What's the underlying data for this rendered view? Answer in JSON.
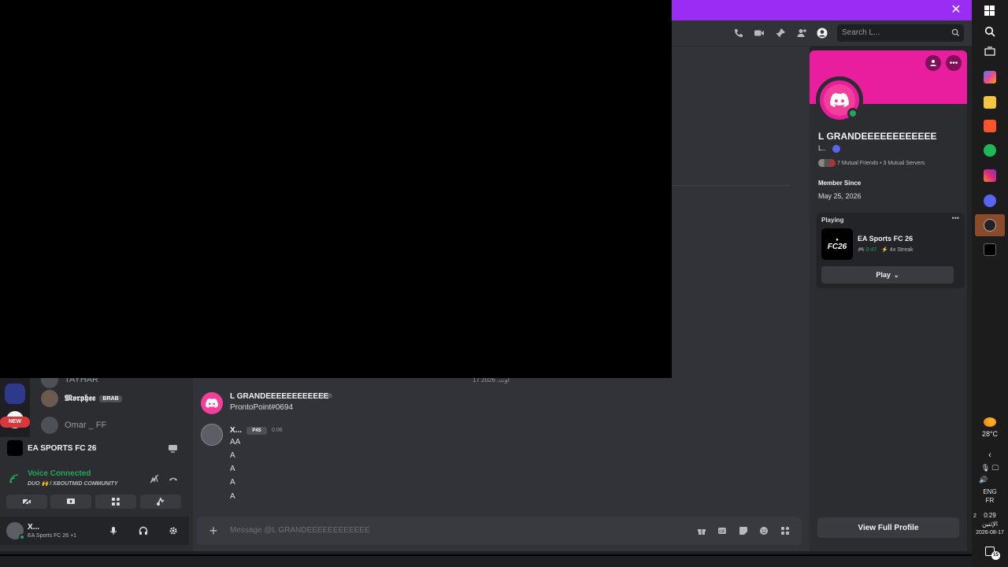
{
  "banner": {
    "color": "#9b2cf3"
  },
  "header": {
    "search_placeholder": "Search L..."
  },
  "chat": {
    "date_divider": "17 2026 ,اوت",
    "messages": [
      {
        "author": "L GRANDEEEEEEEEEEEE",
        "time": "0:05",
        "lines": [
          "ProntoPoint#0694"
        ]
      },
      {
        "author": "X...",
        "tag": "P4S",
        "time": "0:06",
        "lines": [
          "AA",
          "A",
          "A",
          "A",
          "A"
        ]
      }
    ],
    "composer_placeholder": "Message @L GRANDEEEEEEEEEEEE"
  },
  "members": [
    {
      "name": "TAYHAR"
    },
    {
      "name": "𝕸𝖔𝖗𝖕𝖍𝖊𝖊",
      "tag": "BRAB"
    },
    {
      "name": "Omar _ FF"
    }
  ],
  "server_rail": {
    "new_badge": "NEW"
  },
  "activity_bar": {
    "title": "EA SPORTS FC 26"
  },
  "voice": {
    "status": "Voice Connected",
    "channel": "DUO 🙌 / XBOUTMID COMMUNITY",
    "status_color": "#23a55a"
  },
  "user_panel": {
    "name": "X...",
    "status": "EA Sports FC 26 +1"
  },
  "profile": {
    "banner_color": "#e91e9e",
    "display_name": "L GRANDEEEEEEEEEEEE",
    "username": "L..",
    "mutuals": "7 Mutual Friends • 3 Mutual Servers",
    "member_since_label": "Member Since",
    "member_since_value": "May 25, 2026",
    "playing_label": "Playing",
    "game_name": "EA Sports FC 26",
    "game_icon_text": "FC26",
    "game_time": "0:47",
    "game_streak": "4x Streak",
    "play_button": "Play",
    "view_full_profile": "View Full Profile"
  },
  "taskbar": {
    "temperature": "28°C",
    "language_1": "ENG",
    "language_2": "FR",
    "time": "0:29",
    "day": "الإثنين",
    "date": "2026-08-17",
    "notification_count": "15",
    "badge_2": "2"
  }
}
